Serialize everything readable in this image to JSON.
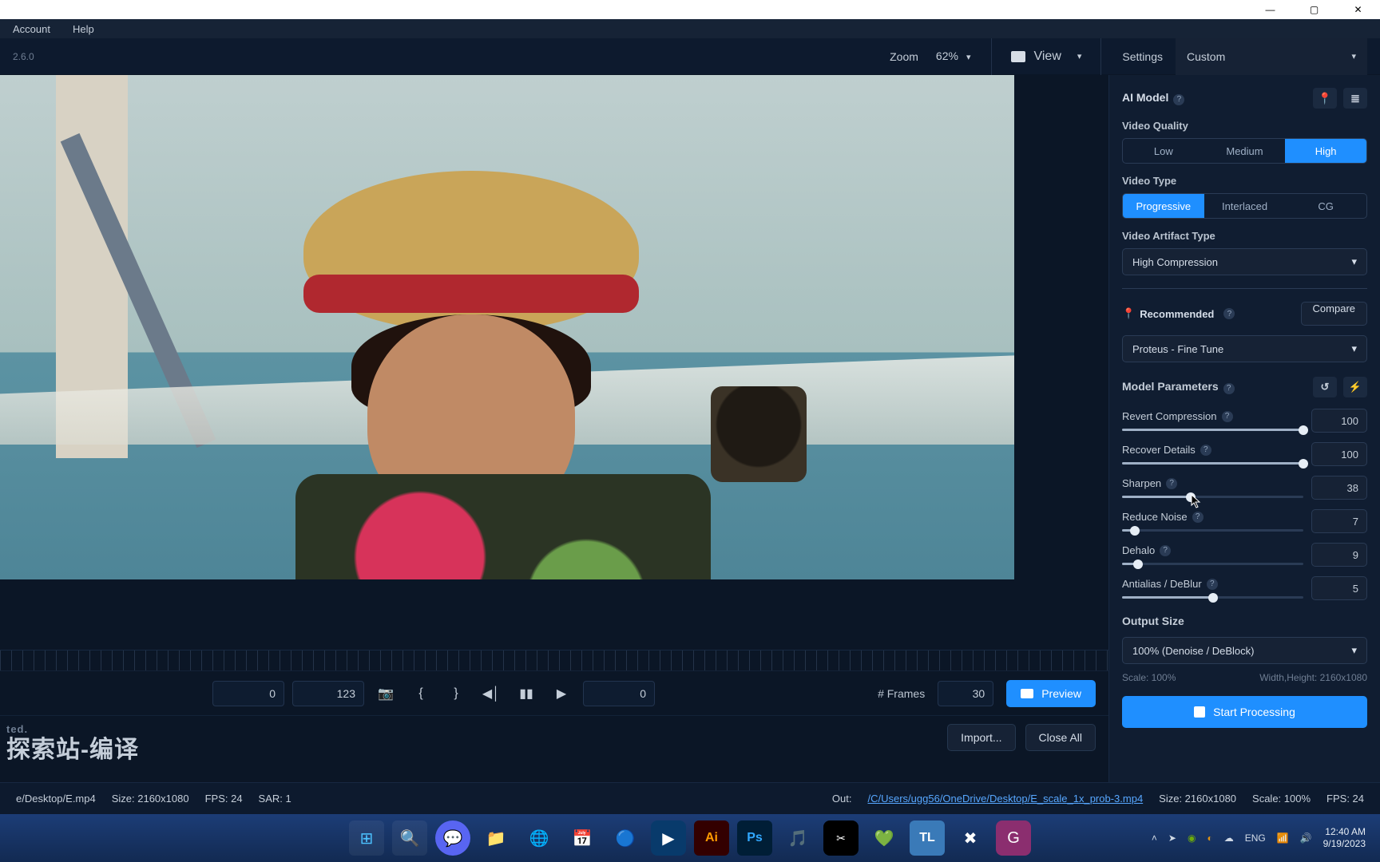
{
  "window": {
    "min": "—",
    "max": "▢",
    "close": "✕"
  },
  "menu": {
    "account": "Account",
    "help": "Help"
  },
  "version": "2.6.0",
  "toolbar": {
    "zoom_label": "Zoom",
    "zoom_value": "62%",
    "view_label": "View",
    "settings_label": "Settings",
    "settings_value": "Custom"
  },
  "right": {
    "ai_model": "AI Model",
    "video_quality": "Video Quality",
    "vq_options": {
      "low": "Low",
      "medium": "Medium",
      "high": "High"
    },
    "video_type": "Video Type",
    "vt_options": {
      "progressive": "Progressive",
      "interlaced": "Interlaced",
      "cg": "CG"
    },
    "artifact_label": "Video Artifact Type",
    "artifact_value": "High Compression",
    "recommended": "Recommended",
    "compare": "Compare",
    "model_value": "Proteus - Fine Tune",
    "model_params": "Model Parameters",
    "params": {
      "revert": {
        "label": "Revert Compression",
        "value": "100",
        "pct": 100
      },
      "recover": {
        "label": "Recover Details",
        "value": "100",
        "pct": 100
      },
      "sharpen": {
        "label": "Sharpen",
        "value": "38",
        "pct": 38
      },
      "noise": {
        "label": "Reduce Noise",
        "value": "7",
        "pct": 7
      },
      "dehalo": {
        "label": "Dehalo",
        "value": "9",
        "pct": 9
      },
      "deblur": {
        "label": "Antialias / DeBlur",
        "value": "5",
        "pct": 50
      }
    },
    "output_size": "Output Size",
    "output_value": "100% (Denoise / DeBlock)",
    "scale_label": "Scale: 100%",
    "dims_label": "Width,Height: 2160x1080",
    "start": "Start Processing"
  },
  "playbar": {
    "pos": "0",
    "total": "123",
    "end": "0",
    "frames_label": "# Frames",
    "frames_value": "30",
    "preview": "Preview"
  },
  "importrow": {
    "wm_small": "ted.",
    "wm": "探索站-编译",
    "import": "Import...",
    "close_all": "Close All"
  },
  "status": {
    "in_file": "e/Desktop/E.mp4",
    "in_size": "Size: 2160x1080",
    "in_fps": "FPS: 24",
    "in_sar": "SAR: 1",
    "out_label": "Out:",
    "out_file": "/C/Users/ugg56/OneDrive/Desktop/E_scale_1x_prob-3.mp4",
    "out_size": "Size: 2160x1080",
    "out_scale": "Scale: 100%",
    "out_fps": "FPS: 24"
  },
  "tray": {
    "time": "12:40 AM",
    "date": "9/19/2023"
  }
}
